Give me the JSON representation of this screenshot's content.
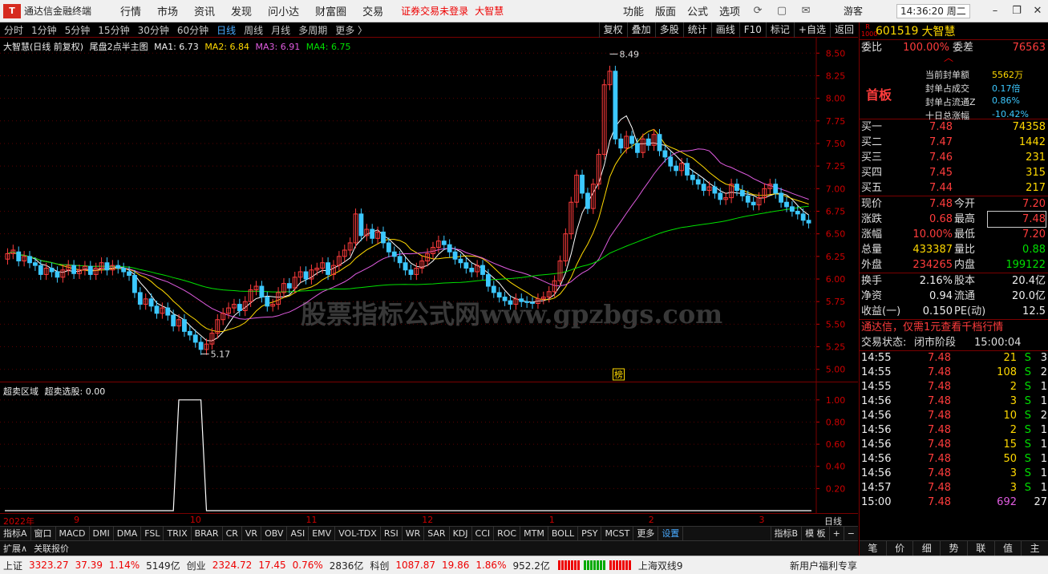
{
  "app": {
    "title": "通达信金融终端",
    "menus": [
      "行情",
      "市场",
      "资讯",
      "发现",
      "问小达",
      "财富圈",
      "交易"
    ],
    "warn": "证券交易未登录",
    "warn_stock": "大智慧",
    "right_menus": [
      "功能",
      "版面",
      "公式",
      "选项"
    ],
    "user": "游客",
    "clock": "14:36:20 周二"
  },
  "periods": [
    "分时",
    "1分钟",
    "5分钟",
    "15分钟",
    "30分钟",
    "60分钟",
    "日线",
    "周线",
    "月线",
    "多周期",
    "更多 〉"
  ],
  "active_period": "日线",
  "tools": [
    "复权",
    "叠加",
    "多股",
    "统计",
    "画线",
    "F10",
    "标记",
    "+自选",
    "返回"
  ],
  "main_legend": {
    "stock": "大智慧(日线 前复权)",
    "formula": "尾盘2点半主图",
    "ma1": "MA1: 6.73",
    "ma2": "MA2: 6.84",
    "ma3": "MA3: 6.91",
    "ma4": "MA4: 6.75",
    "ma_colors": {
      "ma1": "#ffffff",
      "ma2": "#ffd900",
      "ma3": "#e05ce0",
      "ma4": "#00e000"
    },
    "high_label": "8.49",
    "low_label": "5.17",
    "bang_label": "榜"
  },
  "ind_legend": {
    "name": "超卖区域",
    "value": "超卖选股: 0.00"
  },
  "watermark": "股票指标公式网www.gpzbgs.com",
  "chart_data": [
    {
      "type": "candlestick",
      "ylim": [
        4.9,
        8.6
      ],
      "yticks": [
        "8.50",
        "8.25",
        "8.00",
        "7.75",
        "7.50",
        "7.25",
        "7.00",
        "6.75",
        "6.50",
        "6.25",
        "6.00",
        "5.75",
        "5.50",
        "5.25",
        "5.00"
      ],
      "months": [
        "2022年",
        "9",
        "10",
        "11",
        "12",
        "1",
        "2",
        "3"
      ],
      "closes": [
        6.28,
        6.32,
        6.2,
        6.25,
        6.18,
        6.15,
        6.05,
        6.12,
        6.08,
        6.02,
        6.1,
        6.15,
        6.06,
        6.1,
        6.14,
        6.05,
        6.12,
        6.18,
        6.1,
        6.15,
        6.12,
        6.08,
        6.04,
        5.85,
        5.72,
        5.78,
        5.7,
        5.62,
        5.68,
        5.6,
        5.48,
        5.55,
        5.42,
        5.38,
        5.3,
        5.22,
        5.28,
        5.4,
        5.55,
        5.62,
        5.68,
        5.72,
        5.65,
        5.75,
        5.88,
        5.92,
        5.8,
        5.7,
        5.72,
        5.85,
        5.95,
        5.9,
        6.02,
        6.08,
        6.0,
        6.1,
        6.12,
        6.18,
        6.05,
        6.15,
        6.25,
        6.32,
        6.4,
        6.72,
        6.48,
        6.55,
        6.45,
        6.52,
        6.4,
        6.3,
        6.25,
        6.18,
        6.1,
        6.05,
        6.12,
        6.2,
        6.28,
        6.35,
        6.42,
        6.38,
        6.3,
        6.22,
        6.18,
        6.12,
        6.08,
        6.15,
        6.05,
        5.92,
        5.85,
        5.8,
        5.76,
        5.72,
        5.78,
        5.75,
        5.74,
        5.73,
        5.78,
        5.8,
        5.86,
        5.98,
        6.2,
        6.5,
        6.85,
        7.15,
        6.95,
        6.78,
        7.05,
        7.38,
        8.15,
        8.3,
        7.55,
        7.45,
        7.58,
        7.5,
        7.4,
        7.55,
        7.48,
        7.6,
        7.42,
        7.35,
        7.25,
        7.2,
        7.28,
        7.15,
        7.1,
        7.05,
        6.98,
        7.02,
        6.95,
        6.88,
        6.9,
        7.05,
        6.98,
        6.92,
        6.85,
        6.82,
        6.9,
        7.0,
        7.05,
        6.95,
        6.85,
        6.8,
        6.75,
        6.72,
        6.65,
        6.62
      ],
      "opens": [
        6.22,
        6.28,
        6.3,
        6.2,
        6.25,
        6.18,
        6.15,
        6.05,
        6.12,
        6.08,
        6.02,
        6.1,
        6.15,
        6.06,
        6.1,
        6.14,
        6.05,
        6.12,
        6.18,
        6.1,
        6.15,
        6.12,
        6.08,
        6.04,
        5.85,
        5.72,
        5.78,
        5.7,
        5.62,
        5.68,
        5.6,
        5.48,
        5.55,
        5.42,
        5.38,
        5.3,
        5.22,
        5.28,
        5.4,
        5.55,
        5.62,
        5.68,
        5.72,
        5.65,
        5.75,
        5.88,
        5.92,
        5.8,
        5.7,
        5.72,
        5.85,
        5.95,
        5.9,
        6.02,
        6.08,
        6.0,
        6.1,
        6.12,
        6.18,
        6.05,
        6.15,
        6.25,
        6.32,
        6.4,
        6.72,
        6.48,
        6.55,
        6.45,
        6.52,
        6.4,
        6.3,
        6.25,
        6.18,
        6.1,
        6.05,
        6.12,
        6.2,
        6.28,
        6.35,
        6.42,
        6.38,
        6.3,
        6.22,
        6.18,
        6.12,
        6.08,
        6.15,
        6.05,
        5.92,
        5.85,
        5.8,
        5.76,
        5.72,
        5.78,
        5.75,
        5.74,
        5.73,
        5.78,
        5.8,
        5.86,
        5.98,
        6.2,
        6.5,
        6.85,
        7.15,
        6.95,
        6.78,
        7.05,
        7.38,
        8.15,
        8.3,
        7.55,
        7.45,
        7.58,
        7.5,
        7.4,
        7.55,
        7.48,
        7.6,
        7.42,
        7.35,
        7.25,
        7.2,
        7.28,
        7.15,
        7.1,
        7.05,
        6.98,
        7.02,
        6.95,
        6.88,
        6.9,
        7.05,
        6.98,
        6.92,
        6.85,
        6.82,
        6.9,
        7.0,
        7.05,
        6.95,
        6.85,
        6.8,
        6.75,
        6.72,
        6.65
      ],
      "ma_series": [
        "MA1",
        "MA2",
        "MA3",
        "MA4"
      ]
    },
    {
      "type": "line",
      "name": "超卖选股",
      "ylim": [
        0,
        1.1
      ],
      "yticks": [
        "1.00",
        "0.80",
        "0.60",
        "0.40",
        "0.20"
      ],
      "pulse_start_index": 31,
      "pulse_end_index": 35
    }
  ],
  "date_axis_tag": "日线",
  "indicator_tabs": [
    "指标A",
    "窗口",
    "MACD",
    "DMI",
    "DMA",
    "FSL",
    "TRIX",
    "BRAR",
    "CR",
    "VR",
    "OBV",
    "ASI",
    "EMV",
    "VOL-TDX",
    "RSI",
    "WR",
    "SAR",
    "KDJ",
    "CCI",
    "ROC",
    "MTM",
    "BOLL",
    "PSY",
    "MCST",
    "更多",
    "设置"
  ],
  "indicator_active": "设置",
  "indicator_right": [
    "指标B",
    "模 板",
    "+",
    "−"
  ],
  "expand": [
    "扩展∧",
    "关联报价"
  ],
  "quote": {
    "badge": "R 1000",
    "code": "601519",
    "name": "大智慧",
    "webi_label": "委比",
    "webi": "100.00%",
    "wecha_label": "委差",
    "wecha": "76563",
    "seal_tag": "首板",
    "seal_rows": [
      {
        "label": "当前封单额",
        "value": "5562万"
      },
      {
        "label": "封单占成交",
        "value": "0.17倍"
      },
      {
        "label": "封单占流通Z",
        "value": "0.86%"
      },
      {
        "label": "十日总涨幅",
        "value": "-10.42%"
      }
    ],
    "bids": [
      {
        "label": "买一",
        "price": "7.48",
        "vol": "74358"
      },
      {
        "label": "买二",
        "price": "7.47",
        "vol": "1442"
      },
      {
        "label": "买三",
        "price": "7.46",
        "vol": "231"
      },
      {
        "label": "买四",
        "price": "7.45",
        "vol": "315"
      },
      {
        "label": "买五",
        "price": "7.44",
        "vol": "217"
      }
    ],
    "stats": [
      {
        "l1": "现价",
        "v1": "7.48",
        "c1": "red",
        "l2": "今开",
        "v2": "7.20",
        "c2": "red"
      },
      {
        "l1": "涨跌",
        "v1": "0.68",
        "c1": "red",
        "l2": "最高",
        "v2": "7.48",
        "c2": "red"
      },
      {
        "l1": "涨幅",
        "v1": "10.00%",
        "c1": "red",
        "l2": "最低",
        "v2": "7.20",
        "c2": "red"
      },
      {
        "l1": "总量",
        "v1": "433387",
        "c1": "yellow",
        "l2": "量比",
        "v2": "0.88",
        "c2": "green"
      },
      {
        "l1": "外盘",
        "v1": "234265",
        "c1": "red",
        "l2": "内盘",
        "v2": "199122",
        "c2": "green"
      }
    ],
    "stats2": [
      {
        "l1": "换手",
        "v1": "2.16%",
        "l2": "股本",
        "v2": "20.4亿"
      },
      {
        "l1": "净资",
        "v1": "0.94",
        "l2": "流通",
        "v2": "20.0亿"
      },
      {
        "l1": "收益(一)",
        "v1": "0.150",
        "l2": "PE(动)",
        "v2": "12.5"
      }
    ],
    "promo": "通达信，仅需1元查看千档行情",
    "trade_state_label": "交易状态:",
    "trade_state": "闭市阶段",
    "trade_time": "15:00:04",
    "ticks": [
      {
        "t": "14:55",
        "p": "7.48",
        "v": "21",
        "s": "S",
        "n": "3",
        "vc": "yellow"
      },
      {
        "t": "14:55",
        "p": "7.48",
        "v": "108",
        "s": "S",
        "n": "2",
        "vc": "yellow"
      },
      {
        "t": "14:55",
        "p": "7.48",
        "v": "2",
        "s": "S",
        "n": "1",
        "vc": "yellow"
      },
      {
        "t": "14:56",
        "p": "7.48",
        "v": "3",
        "s": "S",
        "n": "1",
        "vc": "yellow"
      },
      {
        "t": "14:56",
        "p": "7.48",
        "v": "10",
        "s": "S",
        "n": "2",
        "vc": "yellow"
      },
      {
        "t": "14:56",
        "p": "7.48",
        "v": "2",
        "s": "S",
        "n": "1",
        "vc": "yellow"
      },
      {
        "t": "14:56",
        "p": "7.48",
        "v": "15",
        "s": "S",
        "n": "1",
        "vc": "yellow"
      },
      {
        "t": "14:56",
        "p": "7.48",
        "v": "50",
        "s": "S",
        "n": "1",
        "vc": "yellow"
      },
      {
        "t": "14:56",
        "p": "7.48",
        "v": "3",
        "s": "S",
        "n": "1",
        "vc": "yellow"
      },
      {
        "t": "14:57",
        "p": "7.48",
        "v": "3",
        "s": "S",
        "n": "1",
        "vc": "yellow"
      },
      {
        "t": "15:00",
        "p": "7.48",
        "v": "692",
        "s": "",
        "n": "27",
        "vc": "magenta"
      }
    ],
    "bottom_tabs": [
      "笔",
      "价",
      "细",
      "势",
      "联",
      "值",
      "主"
    ]
  },
  "status": {
    "sh_label": "上证",
    "sh_val": "3323.27",
    "sh_chg": "37.39",
    "sh_pct": "1.14%",
    "sh_amt": "5149亿",
    "cy_label": "创业",
    "cy_val": "2324.72",
    "cy_chg": "17.45",
    "cy_pct": "0.76%",
    "cy_amt": "2836亿",
    "kc_label": "科创",
    "kc_val": "1087.87",
    "kc_chg": "19.86",
    "kc_pct": "1.86%",
    "kc_amt": "952.2亿",
    "connection": "上海双线9",
    "news": "新用户福利专享"
  }
}
